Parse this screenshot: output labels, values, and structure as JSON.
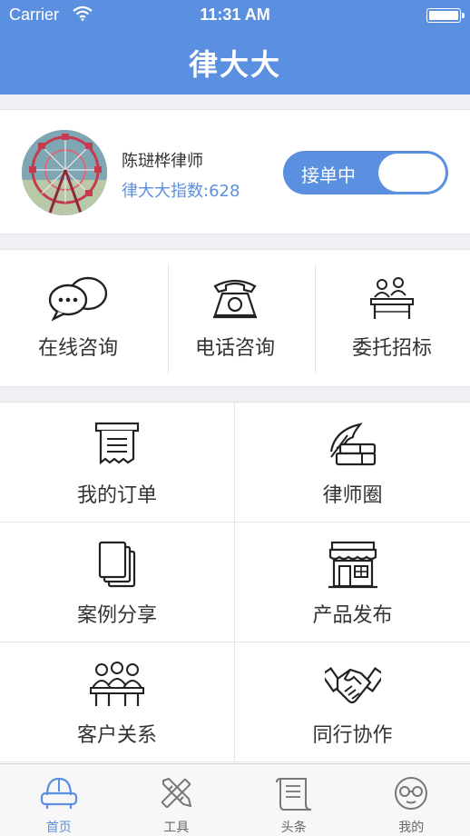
{
  "status_bar": {
    "carrier": "Carrier",
    "time": "11:31 AM"
  },
  "header": {
    "title": "律大大"
  },
  "profile": {
    "name": "陈琎桦律师",
    "index_label": "律大大指数:628",
    "toggle_label": "接单中",
    "toggle_on": true
  },
  "consult": [
    {
      "label": "在线咨询",
      "icon": "chat-bubbles-icon"
    },
    {
      "label": "电话咨询",
      "icon": "telephone-icon"
    },
    {
      "label": "委托招标",
      "icon": "tender-icon"
    }
  ],
  "grid": [
    {
      "label": "我的订单",
      "icon": "receipt-icon"
    },
    {
      "label": "律师圈",
      "icon": "quill-books-icon"
    },
    {
      "label": "案例分享",
      "icon": "documents-icon"
    },
    {
      "label": "产品发布",
      "icon": "store-icon"
    },
    {
      "label": "客户关系",
      "icon": "people-icon"
    },
    {
      "label": "同行协作",
      "icon": "handshake-icon"
    }
  ],
  "tabs": [
    {
      "label": "首页",
      "icon": "sofa-icon",
      "active": true
    },
    {
      "label": "工具",
      "icon": "tools-icon",
      "active": false
    },
    {
      "label": "头条",
      "icon": "scroll-icon",
      "active": false
    },
    {
      "label": "我的",
      "icon": "glasses-face-icon",
      "active": false
    }
  ],
  "colors": {
    "accent": "#5b8fdf",
    "background": "#efeff4",
    "divider": "#e2e2e2"
  }
}
